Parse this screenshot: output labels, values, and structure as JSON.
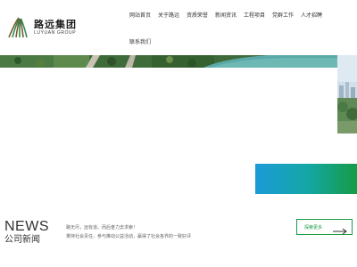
{
  "logo": {
    "name_cn": "路远集团",
    "name_en": "LUYUAN GROUP"
  },
  "nav": {
    "items": [
      {
        "label": "网站首页"
      },
      {
        "label": "关于路远"
      },
      {
        "label": "资质荣誉"
      },
      {
        "label": "新闻资讯"
      },
      {
        "label": "工程项目"
      },
      {
        "label": "党群工作"
      },
      {
        "label": "人才招聘"
      },
      {
        "label": "联系我们"
      }
    ]
  },
  "news": {
    "title_en": "NEWS",
    "title_cn": "公司新闻",
    "line1": "路无尽，远有道。而后奋力去求索！",
    "line2": "秉持社会责任，参与推动公益活动，赢得了社会各界的一致好评",
    "more_label": "探索更多"
  },
  "colors": {
    "accent_green": "#1a9b46",
    "gradient_blue": "#1c9ad6",
    "gradient_green": "#169b46"
  },
  "icons": {
    "logo_mark": "luyuan-logo-mark-icon",
    "more_arrow": "arrow-right-icon"
  }
}
